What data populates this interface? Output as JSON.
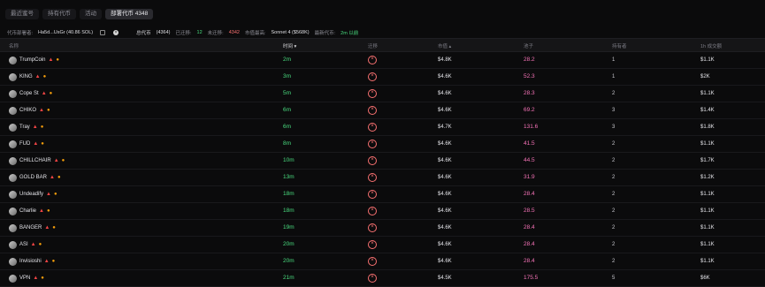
{
  "tabs": [
    "最近蜜号",
    "持有代币",
    "活动",
    "部署代币 4348"
  ],
  "info": {
    "deployer_label": "代币部署者:",
    "deployer_value": "Ha5d...UsGr (40.86 SOL)",
    "total_label": "总代币",
    "total_value": "(4364)",
    "migrated_label": "已迁移:",
    "migrated_value": "12",
    "unmigrated_label": "未迁移:",
    "unmigrated_value": "4342",
    "best_label": "市值最高:",
    "best_value": "Sonnet 4 ($568K)",
    "latest_label": "最新代币:",
    "latest_value": "2m 以前"
  },
  "columns": {
    "name": "名称",
    "time": "时间",
    "migrated": "迁移",
    "marketcap": "市值",
    "pool": "池子",
    "holders": "持有者",
    "volume": "1h 成交额"
  },
  "rows": [
    {
      "name": "TrumpCoin",
      "time": "2m",
      "mc": "$4.8K",
      "pool": "28.2",
      "holders": "1",
      "vol": "$1.1K"
    },
    {
      "name": "KING",
      "time": "3m",
      "mc": "$4.6K",
      "pool": "52.3",
      "holders": "1",
      "vol": "$2K"
    },
    {
      "name": "Cope St",
      "time": "5m",
      "mc": "$4.6K",
      "pool": "28.3",
      "holders": "2",
      "vol": "$1.1K"
    },
    {
      "name": "CHIKO",
      "time": "6m",
      "mc": "$4.6K",
      "pool": "69.2",
      "holders": "3",
      "vol": "$1.4K"
    },
    {
      "name": "Tray",
      "time": "6m",
      "mc": "$4.7K",
      "pool": "131.6",
      "holders": "3",
      "vol": "$1.8K"
    },
    {
      "name": "FUD",
      "time": "8m",
      "mc": "$4.6K",
      "pool": "41.5",
      "holders": "2",
      "vol": "$1.1K"
    },
    {
      "name": "CHILLCHAIR",
      "time": "10m",
      "mc": "$4.6K",
      "pool": "44.5",
      "holders": "2",
      "vol": "$1.7K"
    },
    {
      "name": "GOLD BAR",
      "time": "13m",
      "mc": "$4.6K",
      "pool": "31.9",
      "holders": "2",
      "vol": "$1.2K"
    },
    {
      "name": "Undeadify",
      "time": "18m",
      "mc": "$4.6K",
      "pool": "28.4",
      "holders": "2",
      "vol": "$1.1K"
    },
    {
      "name": "Charlie",
      "time": "18m",
      "mc": "$4.6K",
      "pool": "28.5",
      "holders": "2",
      "vol": "$1.1K"
    },
    {
      "name": "BANGER",
      "time": "19m",
      "mc": "$4.6K",
      "pool": "28.4",
      "holders": "2",
      "vol": "$1.1K"
    },
    {
      "name": "ASI",
      "time": "20m",
      "mc": "$4.6K",
      "pool": "28.4",
      "holders": "2",
      "vol": "$1.1K"
    },
    {
      "name": "Invisioshi",
      "time": "20m",
      "mc": "$4.6K",
      "pool": "28.4",
      "holders": "2",
      "vol": "$1.1K"
    },
    {
      "name": "VPN",
      "time": "21m",
      "mc": "$4.5K",
      "pool": "175.5",
      "holders": "5",
      "vol": "$6K"
    }
  ]
}
